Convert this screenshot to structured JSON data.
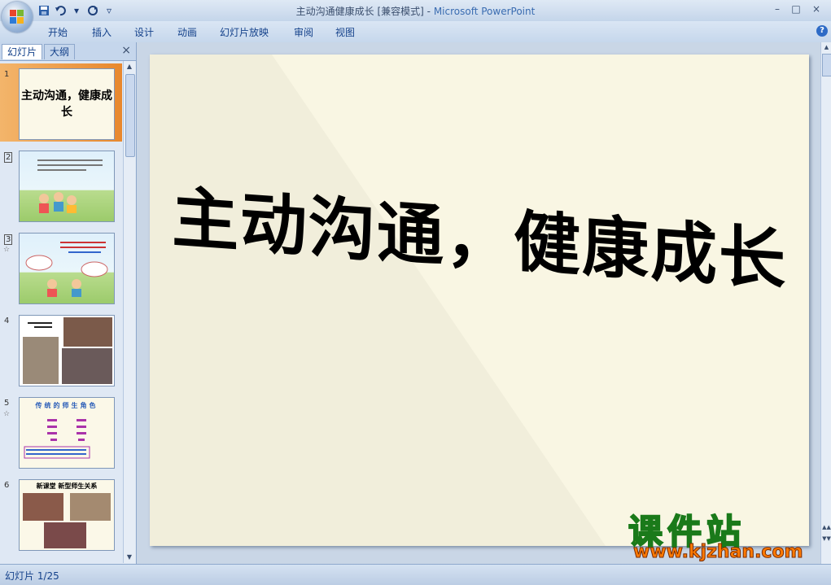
{
  "window": {
    "title_doc": "主动沟通健康成长 [兼容模式]",
    "title_sep": " - ",
    "title_app": "Microsoft PowerPoint"
  },
  "qat": {
    "save_icon": "save-icon",
    "undo_icon": "undo-icon",
    "redo_icon": "redo-icon"
  },
  "menu": [
    "开始",
    "插入",
    "设计",
    "动画",
    "幻灯片放映",
    "审阅",
    "视图"
  ],
  "panel": {
    "tab_slides": "幻灯片",
    "tab_outline": "大纲",
    "close": "×"
  },
  "thumbnails": [
    {
      "num": "1",
      "title": "主动沟通，健康成长",
      "star": ""
    },
    {
      "num": "2",
      "title": "",
      "star": ""
    },
    {
      "num": "3",
      "title": "",
      "star": "☆"
    },
    {
      "num": "4",
      "title": "",
      "star": ""
    },
    {
      "num": "5",
      "title": "传统的师生角色",
      "star": "☆"
    },
    {
      "num": "6",
      "title": "新课堂 新型师生关系",
      "star": ""
    }
  ],
  "slide": {
    "title": "主动沟通，健康成长"
  },
  "status": {
    "slide_counter": "幻灯片 1/25"
  },
  "watermark": {
    "text": "课件站",
    "url": "www.kjzhan.com"
  },
  "colors": {
    "slide_bg": "#f9f6e3",
    "selected_thumb": "#e8882e",
    "ribbon": "#c6d7ec"
  }
}
